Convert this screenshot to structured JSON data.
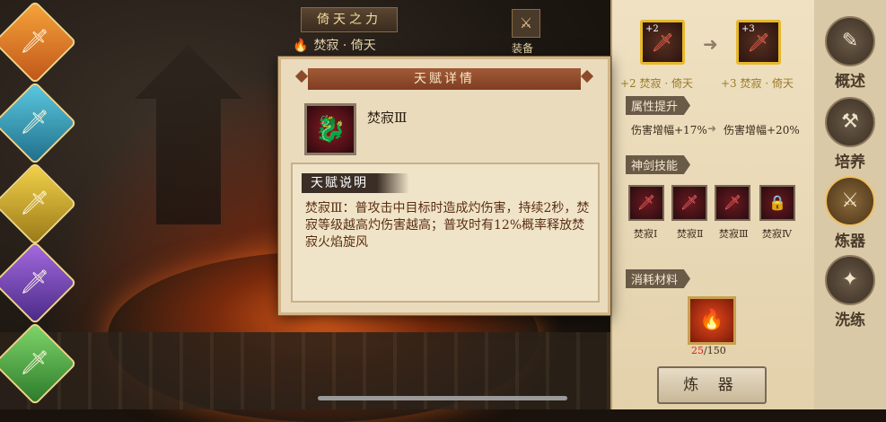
{
  "top_bar": {
    "title": "倚天之力",
    "subtitle": "焚寂 · 倚天",
    "equip_label": "装备"
  },
  "left_skills": [
    {
      "icon": "fire-sword-icon"
    },
    {
      "icon": "ice-sword-icon"
    },
    {
      "icon": "sun-sword-icon"
    },
    {
      "icon": "purple-sword-icon"
    },
    {
      "icon": "green-sword-icon"
    }
  ],
  "modal": {
    "title": "天赋详情",
    "talent_name": "焚寂Ⅲ",
    "desc_label": "天赋说明",
    "description": "焚寂Ⅲ：普攻击中目标时造成灼伤害，持续2秒，焚寂等级越高灼伤害越高；普攻时有12%概率释放焚寂火焰旋风"
  },
  "upgrade": {
    "from_level": "+2",
    "to_level": "+3",
    "from_caption": "+2 焚寂 · 倚天",
    "to_caption": "+3 焚寂 · 倚天"
  },
  "attributes": {
    "header": "属性提升",
    "from": "伤害增幅+17%",
    "to": "伤害增幅+20%"
  },
  "skills": {
    "header": "神剑技能",
    "items": [
      "焚寂Ⅰ",
      "焚寂Ⅱ",
      "焚寂Ⅲ",
      "焚寂Ⅳ"
    ]
  },
  "material": {
    "header": "消耗材料",
    "have": "25",
    "need": "/150"
  },
  "forge_button": "炼 器",
  "nav": [
    {
      "label": "概述",
      "icon": "book-icon",
      "active": false
    },
    {
      "label": "培养",
      "icon": "hammer-icon",
      "active": false
    },
    {
      "label": "炼器",
      "icon": "forge-icon",
      "active": true
    },
    {
      "label": "洗练",
      "icon": "refine-icon",
      "active": false
    }
  ]
}
